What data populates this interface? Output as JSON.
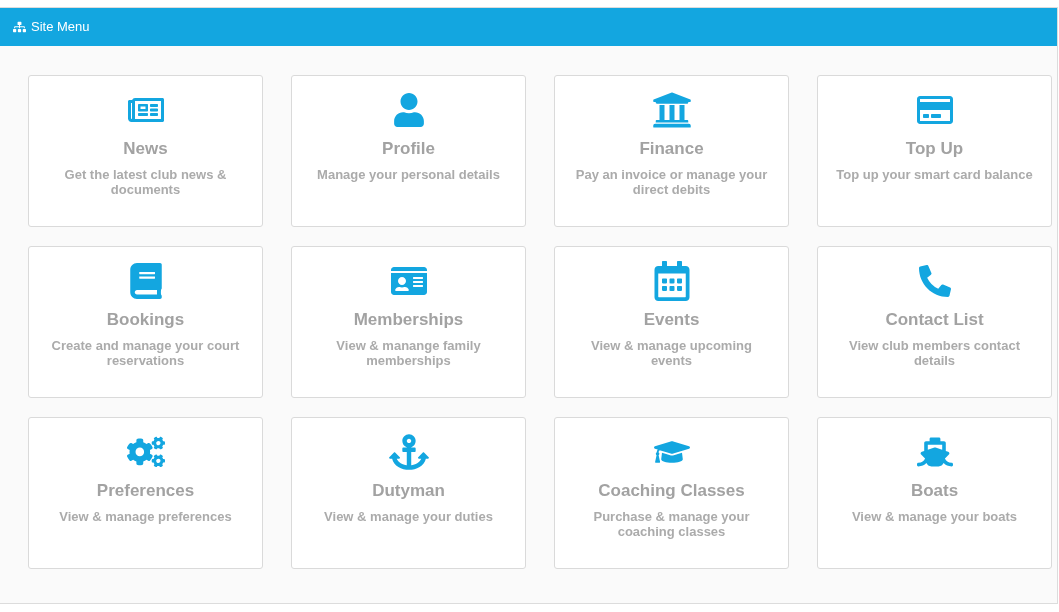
{
  "header": {
    "title": "Site Menu"
  },
  "tiles": [
    {
      "title": "News",
      "description": "Get the latest club news & documents"
    },
    {
      "title": "Profile",
      "description": "Manage your personal details"
    },
    {
      "title": "Finance",
      "description": "Pay an invoice or manage your direct debits"
    },
    {
      "title": "Top Up",
      "description": "Top up your smart card balance"
    },
    {
      "title": "Bookings",
      "description": "Create and manage your court reservations"
    },
    {
      "title": "Memberships",
      "description": "View & manange family memberships"
    },
    {
      "title": "Events",
      "description": "View & manage upcoming events"
    },
    {
      "title": "Contact List",
      "description": "View club members contact details"
    },
    {
      "title": "Preferences",
      "description": "View & manage preferences"
    },
    {
      "title": "Dutyman",
      "description": "View & manage your duties"
    },
    {
      "title": "Coaching Classes",
      "description": "Purchase & manage your coaching classes"
    },
    {
      "title": "Boats",
      "description": "View & manage your boats"
    }
  ]
}
